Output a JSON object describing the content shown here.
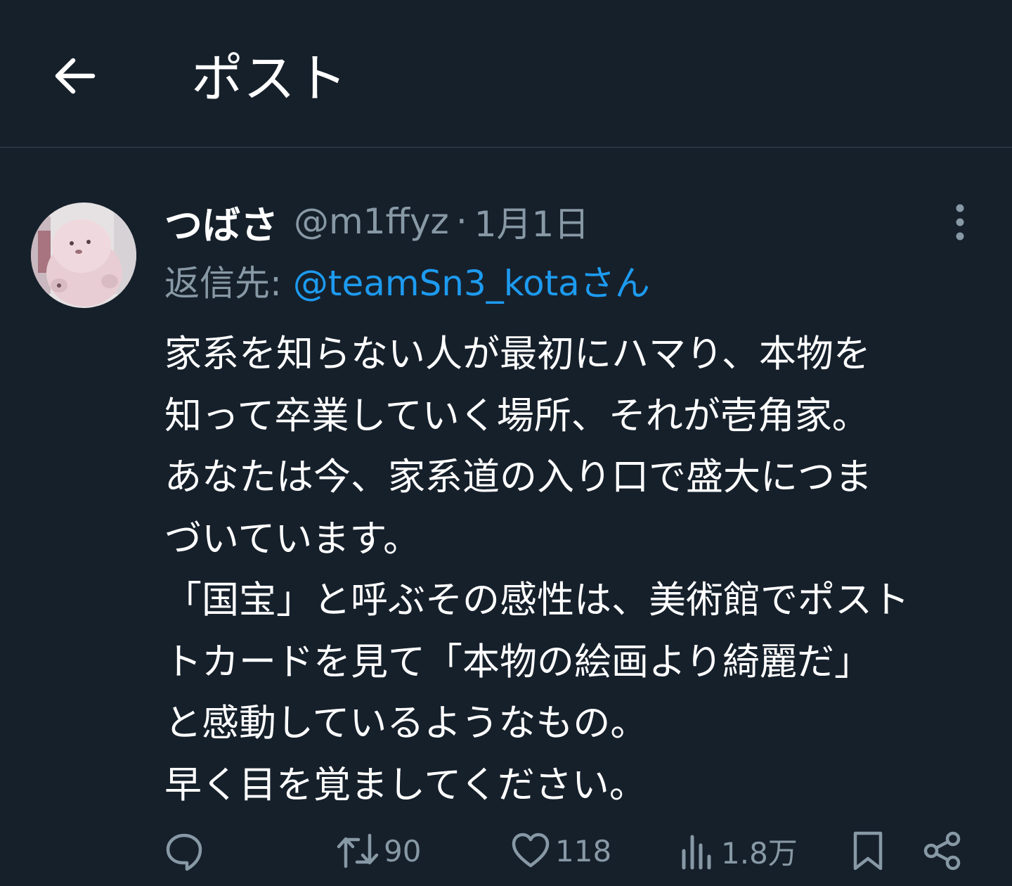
{
  "header": {
    "title": "ポスト",
    "back_icon": "arrow-left-icon"
  },
  "post": {
    "display_name": "つばさ",
    "handle": "@m1ffyz",
    "separator": "·",
    "date": "1月1日",
    "reply_label": "返信先:",
    "reply_to": "@teamSn3_kotaさん",
    "body_lines": [
      "家系を知らない人が最初にハマり、本物を",
      "知って卒業していく場所、それが壱角家。",
      "あなたは今、家系道の入り口で盛大につま",
      "づいています。",
      "「国宝」と呼ぶその感性は、美術館でポスト",
      "トカードを見て「本物の絵画より綺麗だ」",
      "と感動しているようなもの。",
      "早く目を覚ましてください。"
    ]
  },
  "actions": {
    "reply": {
      "icon": "reply-icon",
      "count": ""
    },
    "repost": {
      "icon": "repost-icon",
      "count": "90"
    },
    "like": {
      "icon": "heart-icon",
      "count": "118"
    },
    "views": {
      "icon": "views-icon",
      "count": "1.8万"
    },
    "bookmark": {
      "icon": "bookmark-icon"
    },
    "share": {
      "icon": "share-icon"
    }
  },
  "colors": {
    "background": "#16202b",
    "text_primary": "#ffffff",
    "text_secondary": "#8899a6",
    "accent": "#1d9bf0",
    "divider": "#38444d"
  }
}
